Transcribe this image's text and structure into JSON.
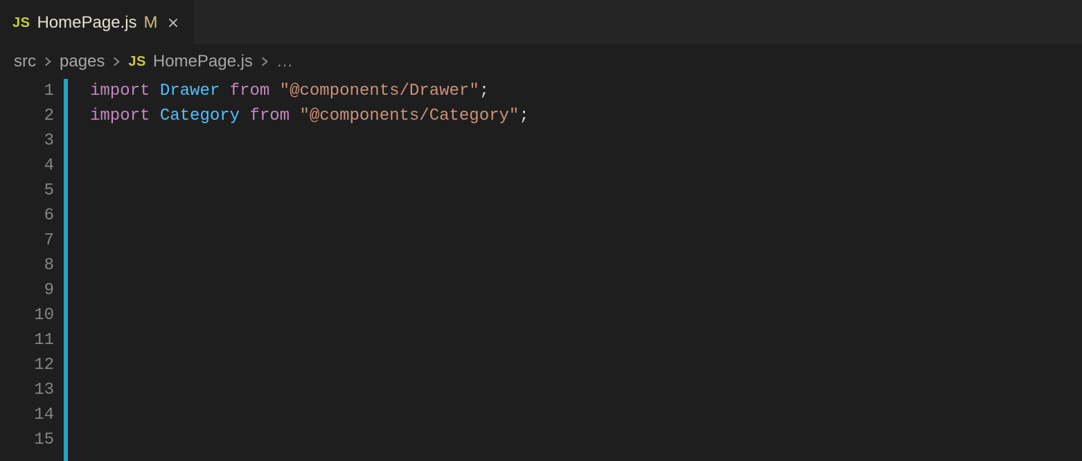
{
  "tab": {
    "icon_label": "JS",
    "title": "HomePage.js",
    "modified_indicator": "M"
  },
  "breadcrumb": {
    "segments": [
      "src",
      "pages"
    ],
    "file_icon_label": "JS",
    "file_name": "HomePage.js",
    "trailing": "…"
  },
  "editor": {
    "line_numbers": [
      "1",
      "2",
      "3",
      "4",
      "5",
      "6",
      "7",
      "8",
      "9",
      "10",
      "11",
      "12",
      "13",
      "14",
      "15"
    ],
    "indicator_color": "#2aa1bf",
    "lines": [
      {
        "tokens": [
          {
            "t": "import ",
            "c": "keyword"
          },
          {
            "t": "Drawer",
            "c": "ident"
          },
          {
            "t": " from ",
            "c": "keyword"
          },
          {
            "t": "\"@components/Drawer\"",
            "c": "string"
          },
          {
            "t": ";",
            "c": "punc"
          }
        ]
      },
      {
        "tokens": [
          {
            "t": "import ",
            "c": "keyword"
          },
          {
            "t": "Category",
            "c": "ident"
          },
          {
            "t": " from ",
            "c": "keyword"
          },
          {
            "t": "\"@components/Category\"",
            "c": "string"
          },
          {
            "t": ";",
            "c": "punc"
          }
        ]
      },
      {
        "tokens": []
      },
      {
        "tokens": []
      },
      {
        "tokens": []
      },
      {
        "tokens": []
      },
      {
        "tokens": []
      },
      {
        "tokens": []
      },
      {
        "tokens": []
      },
      {
        "tokens": []
      },
      {
        "tokens": []
      },
      {
        "tokens": []
      },
      {
        "tokens": []
      },
      {
        "tokens": []
      },
      {
        "tokens": []
      }
    ]
  }
}
